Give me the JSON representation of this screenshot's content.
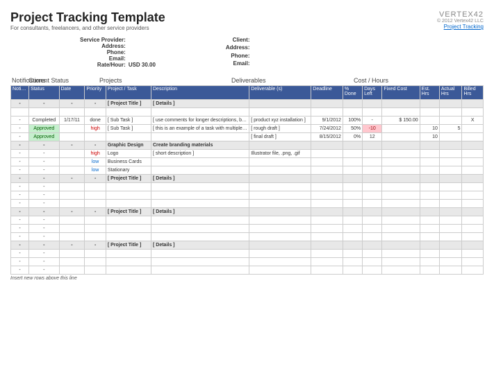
{
  "header": {
    "title": "Project Tracking Template",
    "subtitle": "For consultants, freelancers, and other service providers",
    "logo_text": "VERTEX42",
    "copyright": "© 2012 Vertex42 LLC",
    "link_text": "Project Tracking"
  },
  "provider": {
    "labels": [
      "Service Provider:",
      "Address:",
      "Phone:",
      "Email:",
      "Rate/Hour:"
    ],
    "rate_value": "USD 30.00"
  },
  "client": {
    "labels": [
      "Client:",
      "Address:",
      "Phone:",
      "Email:"
    ]
  },
  "sections": {
    "notifications": "Notifications",
    "current_status": "Current Status",
    "projects": "Projects",
    "deliverables": "Deliverables",
    "cost_hours": "Cost / Hours"
  },
  "columns": [
    "Notifications",
    "Status",
    "Date",
    "Priority",
    "Project / Task",
    "Description",
    "Deliverable (s)",
    "Deadline",
    "% Done",
    "Days Left",
    "Fixed Cost",
    "Est. Hrs",
    "Actual Hrs",
    "Billed Hrs"
  ],
  "rows": [
    {
      "type": "group",
      "dash": true,
      "task": "[ Project Title ]",
      "desc": "[ Details ]"
    },
    {
      "type": "blank"
    },
    {
      "type": "data",
      "noti": "-",
      "status": "Completed",
      "status_cls": "completed",
      "date": "1/17/11",
      "priority": "done",
      "task": "[ Sub Task ]",
      "desc": "[ use comments for longer descriptions, but this field will also wrap ]",
      "deliv": "[ product xyz installation ]",
      "deadline": "9/1/2012",
      "pct": "100%",
      "days": "-",
      "cost": "$    150.00",
      "est": "",
      "actual": "",
      "billed": "X"
    },
    {
      "type": "data",
      "noti": "-",
      "status": "Approved",
      "status_cls": "approved",
      "date": "",
      "priority": "high",
      "priority_cls": "high",
      "task": "[ Sub Task ]",
      "desc": "[ this is an example of a task with multiple deliverables (rough and final drafts) ]",
      "deliv": "[ rough draft ]",
      "deadline": "7/24/2012",
      "pct": "50%",
      "days": "-10",
      "days_cls": "neg",
      "cost": "",
      "est": "10",
      "actual": "5",
      "billed": ""
    },
    {
      "type": "data",
      "noti": "-",
      "status": "Approved",
      "status_cls": "approved",
      "date": "",
      "priority": "",
      "task": "",
      "desc": "",
      "deliv": "[ final draft ]",
      "deadline": "8/15/2012",
      "pct": "0%",
      "days": "12",
      "cost": "",
      "est": "10",
      "actual": "",
      "billed": ""
    },
    {
      "type": "group",
      "dash": true,
      "task": "Graphic Design",
      "desc": "Create branding materials"
    },
    {
      "type": "data",
      "noti": "-",
      "status": "-",
      "date": "",
      "priority": "high",
      "priority_cls": "high",
      "task": "Logo",
      "desc": "[ short description ]",
      "deliv": "Illustrator file, .png, .gif",
      "deadline": "",
      "pct": "",
      "days": "",
      "cost": "",
      "est": "",
      "actual": "",
      "billed": ""
    },
    {
      "type": "data",
      "noti": "-",
      "status": "-",
      "date": "",
      "priority": "low",
      "priority_cls": "low",
      "task": "Business Cards",
      "desc": "",
      "deliv": "",
      "deadline": "",
      "pct": "",
      "days": "",
      "cost": "",
      "est": "",
      "actual": "",
      "billed": ""
    },
    {
      "type": "data",
      "noti": "-",
      "status": "-",
      "date": "",
      "priority": "low",
      "priority_cls": "low",
      "task": "Stationary",
      "desc": "",
      "deliv": "",
      "deadline": "",
      "pct": "",
      "days": "",
      "cost": "",
      "est": "",
      "actual": "",
      "billed": ""
    },
    {
      "type": "group",
      "dash": true,
      "task": "[ Project Title ]",
      "desc": "[ Details ]"
    },
    {
      "type": "data",
      "noti": "-",
      "status": "-"
    },
    {
      "type": "data",
      "noti": "-",
      "status": "-"
    },
    {
      "type": "data",
      "noti": "-",
      "status": "-"
    },
    {
      "type": "group",
      "dash": true,
      "task": "[ Project Title ]",
      "desc": "[ Details ]"
    },
    {
      "type": "data",
      "noti": "-",
      "status": "-"
    },
    {
      "type": "data",
      "noti": "-",
      "status": "-"
    },
    {
      "type": "data",
      "noti": "-",
      "status": "-"
    },
    {
      "type": "group",
      "dash": true,
      "task": "[ Project Title ]",
      "desc": "[ Details ]"
    },
    {
      "type": "data",
      "noti": "-",
      "status": "-"
    },
    {
      "type": "data",
      "noti": "-",
      "status": "-"
    },
    {
      "type": "data",
      "noti": "-",
      "status": "-"
    }
  ],
  "footer": "Insert new rows above this line"
}
